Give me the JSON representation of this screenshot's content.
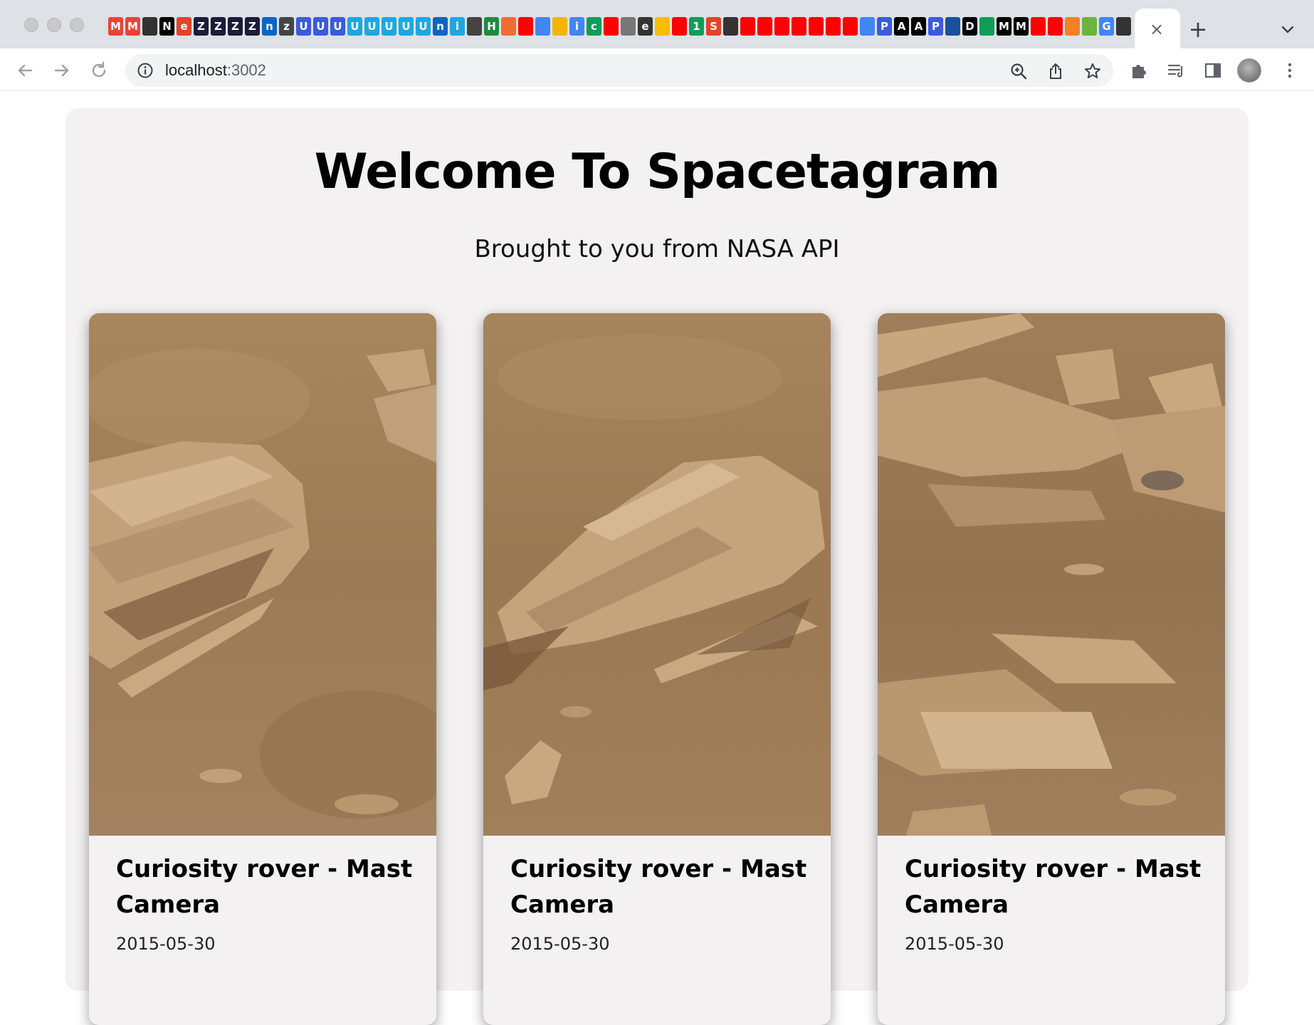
{
  "browser": {
    "url_host": "localhost",
    "url_port": ":3002",
    "tab_close_glyph": "×",
    "new_tab_glyph": "+"
  },
  "favicons": [
    {
      "letter": "M",
      "color": "#ea4335"
    },
    {
      "letter": "M",
      "color": "#ea4335"
    },
    {
      "letter": "",
      "color": "#333333"
    },
    {
      "letter": "N",
      "color": "#000000"
    },
    {
      "letter": "e",
      "color": "#e24329"
    },
    {
      "letter": "Z",
      "color": "#1b1b3a"
    },
    {
      "letter": "Z",
      "color": "#1b1b3a"
    },
    {
      "letter": "Z",
      "color": "#1b1b3a"
    },
    {
      "letter": "Z",
      "color": "#1b1b3a"
    },
    {
      "letter": "n",
      "color": "#0a66c2"
    },
    {
      "letter": "z",
      "color": "#444444"
    },
    {
      "letter": "U",
      "color": "#3b5bdb"
    },
    {
      "letter": "U",
      "color": "#3b5bdb"
    },
    {
      "letter": "U",
      "color": "#3b5bdb"
    },
    {
      "letter": "U",
      "color": "#1ea7e1"
    },
    {
      "letter": "U",
      "color": "#1ea7e1"
    },
    {
      "letter": "U",
      "color": "#1ea7e1"
    },
    {
      "letter": "U",
      "color": "#1ea7e1"
    },
    {
      "letter": "U",
      "color": "#1ea7e1"
    },
    {
      "letter": "n",
      "color": "#0a66c2"
    },
    {
      "letter": "i",
      "color": "#1ea7e1"
    },
    {
      "letter": "",
      "color": "#444444"
    },
    {
      "letter": "H",
      "color": "#1f8a3e"
    },
    {
      "letter": "",
      "color": "#f06d2f"
    },
    {
      "letter": "",
      "color": "#ff0000"
    },
    {
      "letter": "",
      "color": "#4285f4"
    },
    {
      "letter": "",
      "color": "#f4b400"
    },
    {
      "letter": "i",
      "color": "#4285f4"
    },
    {
      "letter": "c",
      "color": "#0f9d58"
    },
    {
      "letter": "",
      "color": "#ff0000"
    },
    {
      "letter": "",
      "color": "#777777"
    },
    {
      "letter": "e",
      "color": "#333333"
    },
    {
      "letter": "",
      "color": "#fbbc04"
    },
    {
      "letter": "",
      "color": "#ff0000"
    },
    {
      "letter": "1",
      "color": "#0f9d58"
    },
    {
      "letter": "S",
      "color": "#e24329"
    },
    {
      "letter": "",
      "color": "#333333"
    },
    {
      "letter": "",
      "color": "#ff0000"
    },
    {
      "letter": "",
      "color": "#ff0000"
    },
    {
      "letter": "",
      "color": "#ff0000"
    },
    {
      "letter": "",
      "color": "#ff0000"
    },
    {
      "letter": "",
      "color": "#ff0000"
    },
    {
      "letter": "",
      "color": "#ff0000"
    },
    {
      "letter": "",
      "color": "#ff0000"
    },
    {
      "letter": "",
      "color": "#4285f4"
    },
    {
      "letter": "P",
      "color": "#3b5bdb"
    },
    {
      "letter": "A",
      "color": "#000000"
    },
    {
      "letter": "A",
      "color": "#000000"
    },
    {
      "letter": "P",
      "color": "#3b5bdb"
    },
    {
      "letter": "",
      "color": "#1b4f9c"
    },
    {
      "letter": "D",
      "color": "#000000"
    },
    {
      "letter": "",
      "color": "#0f9d58"
    },
    {
      "letter": "M",
      "color": "#000000"
    },
    {
      "letter": "M",
      "color": "#000000"
    },
    {
      "letter": "",
      "color": "#ff0000"
    },
    {
      "letter": "",
      "color": "#ff0000"
    },
    {
      "letter": "",
      "color": "#f48024"
    },
    {
      "letter": "",
      "color": "#6cb33f"
    },
    {
      "letter": "G",
      "color": "#4285f4"
    },
    {
      "letter": "",
      "color": "#333333"
    }
  ],
  "page": {
    "title": "Welcome To Spacetagram",
    "subtitle": "Brought to you from NASA API"
  },
  "cards": [
    {
      "title": "Curiosity rover - Mast Camera",
      "date": "2015-05-30"
    },
    {
      "title": "Curiosity rover - Mast Camera",
      "date": "2015-05-30"
    },
    {
      "title": "Curiosity rover - Mast Camera",
      "date": "2015-05-30"
    }
  ]
}
